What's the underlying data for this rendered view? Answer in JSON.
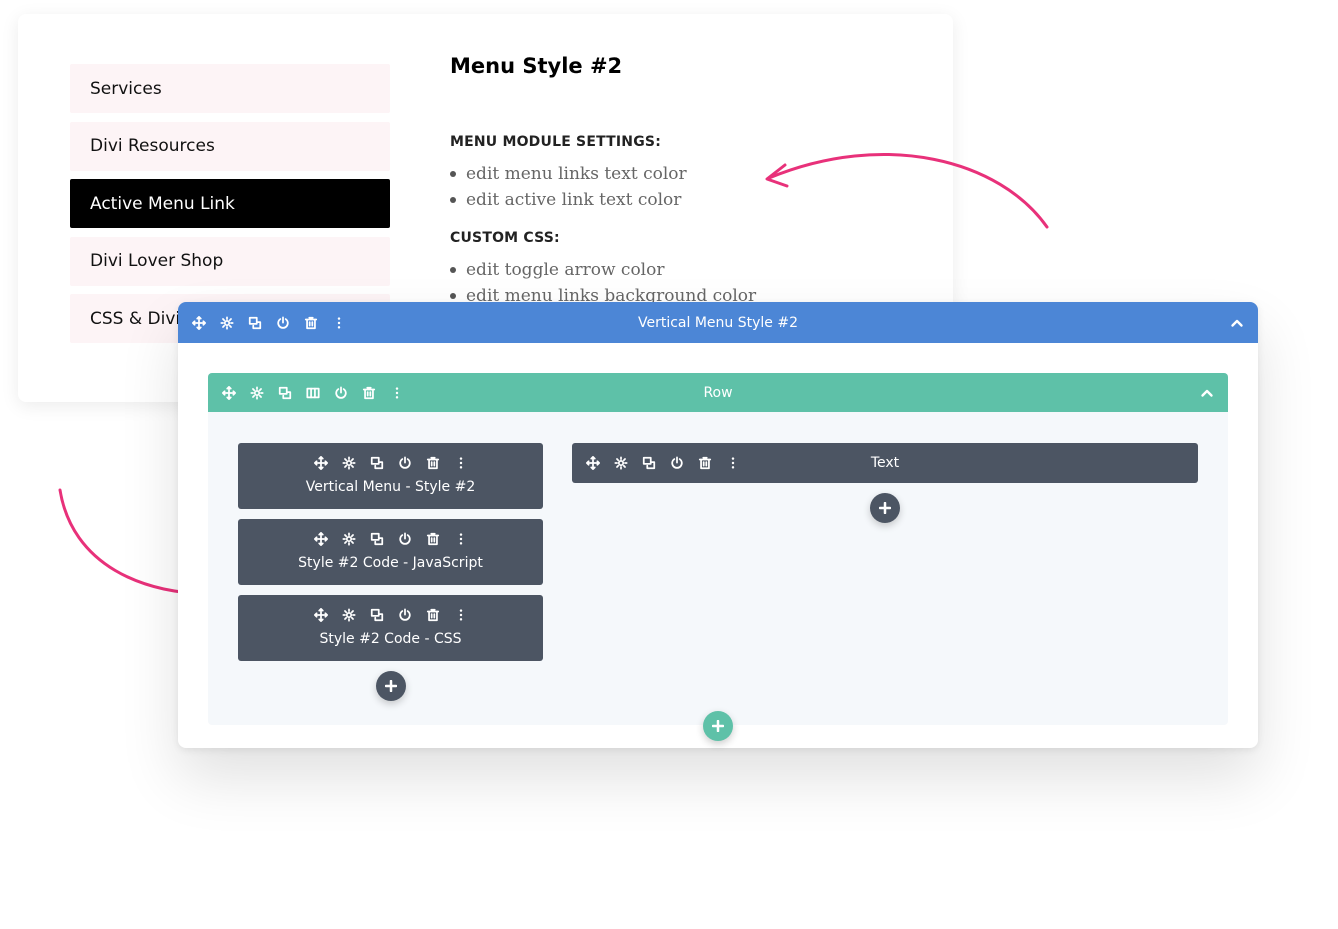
{
  "preview": {
    "menu_items": [
      {
        "label": "Services",
        "active": false
      },
      {
        "label": "Divi Resources",
        "active": false
      },
      {
        "label": "Active Menu Link",
        "active": true
      },
      {
        "label": "Divi Lover Shop",
        "active": false
      },
      {
        "label": "CSS & Divi",
        "active": false
      }
    ],
    "title": "Menu Style #2",
    "module_settings_heading": "MENU MODULE SETTINGS:",
    "module_settings": [
      "edit menu links text color",
      "edit active link text color"
    ],
    "custom_css_heading": "CUSTOM CSS:",
    "custom_css": [
      "edit toggle arrow color",
      "edit menu links background color"
    ]
  },
  "builder": {
    "section_title": "Vertical Menu Style #2",
    "row_title": "Row",
    "left_modules": [
      "Vertical Menu - Style #2",
      "Style #2 Code - JavaScript",
      "Style #2 Code - CSS"
    ],
    "right_module": "Text"
  },
  "colors": {
    "section_bar": "#4c86d6",
    "row_bar": "#5ec1a8",
    "module": "#4c5563",
    "arrow": "#e8317a",
    "active_menu": "#000000"
  },
  "icons": [
    "move-icon",
    "gear-icon",
    "duplicate-icon",
    "columns-icon",
    "power-icon",
    "trash-icon",
    "more-icon",
    "chevron-up-icon",
    "plus-icon"
  ]
}
